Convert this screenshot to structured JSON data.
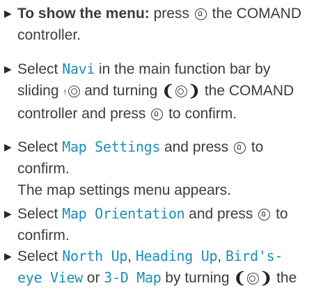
{
  "steps": [
    {
      "bold_lead": "To show the menu:",
      "t1": " press ",
      "t2": " the COMAND",
      "t3": "controller."
    },
    {
      "t1": "Select ",
      "code1": "Navi",
      "t2": " in the main function bar by",
      "t3": "sliding ",
      "t4": " and turning ",
      "t5": " the COMAND",
      "t6": "controller and press ",
      "t7": " to confirm."
    },
    {
      "t1": "Select ",
      "code1": "Map Settings",
      "t2": " and press ",
      "t3": " to",
      "t4": "confirm.",
      "t5": "The map settings menu appears."
    },
    {
      "t1": "Select ",
      "code1": "Map Orientation",
      "t2": " and press ",
      "t3": " to",
      "t4": "confirm."
    },
    {
      "t1": "Select ",
      "code1": "North Up",
      "sep1": ", ",
      "code2": "Heading Up",
      "sep2": ", ",
      "code3": "Bird's-",
      "code4": "eye View",
      "sep3": " or ",
      "code5": "3-D Map",
      "t2": " by turning ",
      "t3": " the"
    }
  ],
  "bullet_glyph": "▶",
  "arrow_up_glyph": "↑",
  "turn_left_glyph": "❨",
  "turn_right_glyph": "❩",
  "icons": [
    "press-controller-icon",
    "slide-up-icon",
    "turn-controller-icon"
  ],
  "colors": {
    "text": "#3c3c3c",
    "highlight": "#1a8fb8"
  }
}
